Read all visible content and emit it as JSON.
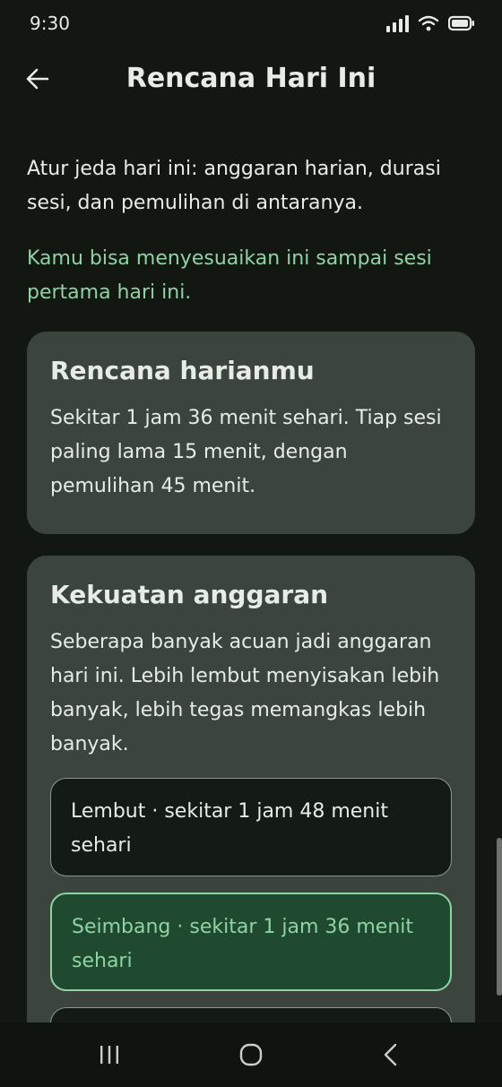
{
  "status_bar": {
    "time": "9:30"
  },
  "app_bar": {
    "title": "Rencana Hari Ini"
  },
  "intro_text": "Atur jeda hari ini: anggaran harian, durasi sesi, dan pemulihan di antaranya.",
  "note_text": "Kamu bisa menyesuaikan ini sampai sesi pertama hari ini.",
  "plan_card": {
    "title": "Rencana harianmu",
    "body": "Sekitar 1 jam 36 menit sehari. Tiap sesi paling lama 15 menit, dengan pemulihan 45 menit."
  },
  "budget_card": {
    "title": "Kekuatan anggaran",
    "body": "Seberapa banyak acuan jadi anggaran hari ini. Lebih lembut menyisakan lebih banyak, lebih tegas memangkas lebih banyak.",
    "options": [
      {
        "label": "Lembut · sekitar 1 jam 48 menit sehari",
        "selected": false
      },
      {
        "label": "Seimbang · sekitar 1 jam 36 menit sehari",
        "selected": true
      }
    ]
  },
  "colors": {
    "background": "#121712",
    "card": "#3b443d",
    "accent": "#8fd3a4",
    "selected_fill": "#1f4a30"
  },
  "icons": [
    "back-arrow-icon",
    "signal-icon",
    "wifi-icon",
    "battery-icon",
    "recents-icon",
    "home-icon",
    "back-nav-icon"
  ]
}
